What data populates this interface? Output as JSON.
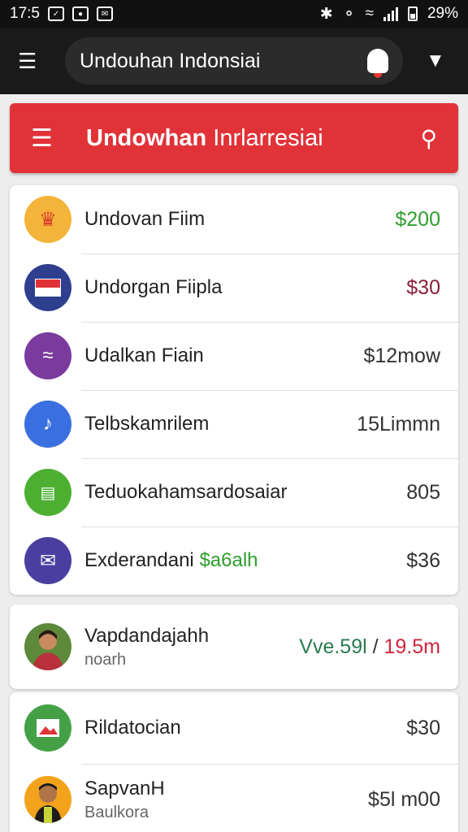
{
  "status_bar": {
    "time": "17:5",
    "battery": "29%"
  },
  "top_bar": {
    "search_text": "Undouhan Indonsiai"
  },
  "header": {
    "title_bold": "Undowhan",
    "title_rest": "Inrlarresiai"
  },
  "list": [
    {
      "label": "Undovan Fiim",
      "value": "$200",
      "icon": "crown-icon",
      "color": "#f4b43a"
    },
    {
      "label": "Undorgan Fiipla",
      "value": "$30",
      "icon": "flag-icon",
      "color": "#2e3f8f"
    },
    {
      "label": "Udalkan Fiain",
      "value": "$12mow",
      "icon": "wave-icon",
      "color": "#7b3a9e"
    },
    {
      "label": "Telbskamrilem",
      "value": "15Limmn",
      "icon": "music-note-icon",
      "color": "#3a6fe0"
    },
    {
      "label": "Teduokahamsardosaiar",
      "value": "805",
      "icon": "card-icon",
      "color": "#4caf32"
    },
    {
      "label": "Exderandani",
      "label_extra": "$a6alh",
      "value": "$36",
      "icon": "mail-icon",
      "color": "#4a3ea0"
    }
  ],
  "profile": {
    "name": "Vapdandajahh",
    "subtitle": "noarh",
    "value_left": "Vve.59l",
    "separator": "/",
    "value_right": "19.5m"
  },
  "bottom": [
    {
      "label": "Rildatocian",
      "value": "$30",
      "icon": "image-icon",
      "color": "#43a047"
    },
    {
      "label": "SapvanH",
      "subtitle": "Baulkora",
      "value": "$5l m00",
      "icon": "person-avatar",
      "color": "#f2a21b"
    }
  ]
}
